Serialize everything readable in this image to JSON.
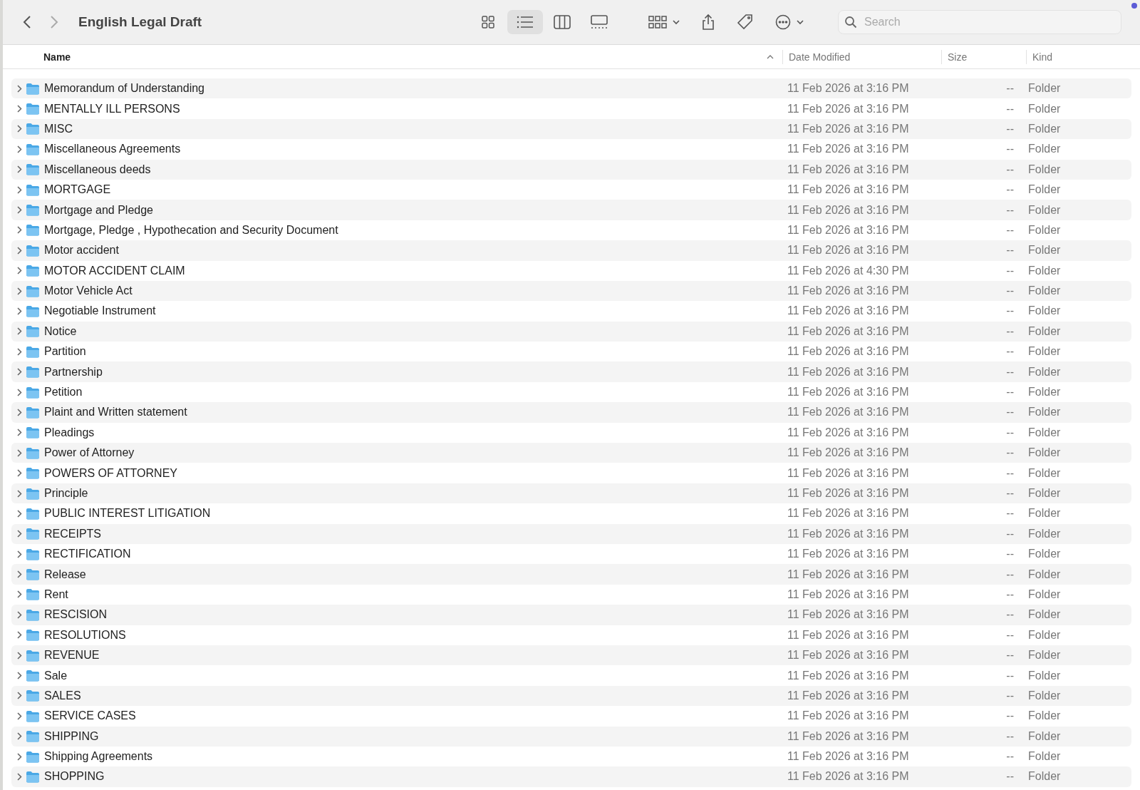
{
  "window": {
    "title": "English Legal Draft"
  },
  "toolbar": {
    "views": [
      {
        "kind": "icons",
        "selected": false
      },
      {
        "kind": "list",
        "selected": true
      },
      {
        "kind": "columns",
        "selected": false
      },
      {
        "kind": "gallery",
        "selected": false
      }
    ],
    "search": {
      "placeholder": "Search"
    }
  },
  "table": {
    "columns": [
      {
        "label": "Name",
        "sorted": true
      },
      {
        "label": "Date Modified",
        "sorted": false
      },
      {
        "label": "Size",
        "sorted": false
      },
      {
        "label": "Kind",
        "sorted": false
      }
    ],
    "rows": [
      {
        "name": "Memorandum of Understanding",
        "date": "11 Feb 2026 at 3:16 PM",
        "size": "--",
        "kind": "Folder",
        "expanded": false
      },
      {
        "name": "MENTALLY ILL PERSONS",
        "date": "11 Feb 2026 at 3:16 PM",
        "size": "--",
        "kind": "Folder",
        "expanded": false
      },
      {
        "name": "MISC",
        "date": "11 Feb 2026 at 3:16 PM",
        "size": "--",
        "kind": "Folder",
        "expanded": false
      },
      {
        "name": "Miscellaneous Agreements",
        "date": "11 Feb 2026 at 3:16 PM",
        "size": "--",
        "kind": "Folder",
        "expanded": false
      },
      {
        "name": "Miscellaneous deeds",
        "date": "11 Feb 2026 at 3:16 PM",
        "size": "--",
        "kind": "Folder",
        "expanded": false
      },
      {
        "name": "MORTGAGE",
        "date": "11 Feb 2026 at 3:16 PM",
        "size": "--",
        "kind": "Folder",
        "expanded": false
      },
      {
        "name": "Mortgage and Pledge",
        "date": "11 Feb 2026 at 3:16 PM",
        "size": "--",
        "kind": "Folder",
        "expanded": false
      },
      {
        "name": "Mortgage, Pledge , Hypothecation and Security Document",
        "date": "11 Feb 2026 at 3:16 PM",
        "size": "--",
        "kind": "Folder",
        "expanded": false
      },
      {
        "name": "Motor accident",
        "date": "11 Feb 2026 at 3:16 PM",
        "size": "--",
        "kind": "Folder",
        "expanded": false
      },
      {
        "name": "MOTOR ACCIDENT CLAIM",
        "date": "11 Feb 2026 at 4:30 PM",
        "size": "--",
        "kind": "Folder",
        "expanded": false
      },
      {
        "name": "Motor Vehicle Act",
        "date": "11 Feb 2026 at 3:16 PM",
        "size": "--",
        "kind": "Folder",
        "expanded": false
      },
      {
        "name": "Negotiable Instrument",
        "date": "11 Feb 2026 at 3:16 PM",
        "size": "--",
        "kind": "Folder",
        "expanded": false
      },
      {
        "name": "Notice",
        "date": "11 Feb 2026 at 3:16 PM",
        "size": "--",
        "kind": "Folder",
        "expanded": false
      },
      {
        "name": "Partition",
        "date": "11 Feb 2026 at 3:16 PM",
        "size": "--",
        "kind": "Folder",
        "expanded": false
      },
      {
        "name": "Partnership",
        "date": "11 Feb 2026 at 3:16 PM",
        "size": "--",
        "kind": "Folder",
        "expanded": false
      },
      {
        "name": "Petition",
        "date": "11 Feb 2026 at 3:16 PM",
        "size": "--",
        "kind": "Folder",
        "expanded": false
      },
      {
        "name": "Plaint and Written statement",
        "date": "11 Feb 2026 at 3:16 PM",
        "size": "--",
        "kind": "Folder",
        "expanded": false
      },
      {
        "name": "Pleadings",
        "date": "11 Feb 2026 at 3:16 PM",
        "size": "--",
        "kind": "Folder",
        "expanded": false
      },
      {
        "name": "Power of Attorney",
        "date": "11 Feb 2026 at 3:16 PM",
        "size": "--",
        "kind": "Folder",
        "expanded": false
      },
      {
        "name": "POWERS OF ATTORNEY",
        "date": "11 Feb 2026 at 3:16 PM",
        "size": "--",
        "kind": "Folder",
        "expanded": false
      },
      {
        "name": "Principle",
        "date": "11 Feb 2026 at 3:16 PM",
        "size": "--",
        "kind": "Folder",
        "expanded": false
      },
      {
        "name": "PUBLIC INTEREST LITIGATION",
        "date": "11 Feb 2026 at 3:16 PM",
        "size": "--",
        "kind": "Folder",
        "expanded": false
      },
      {
        "name": "RECEIPTS",
        "date": "11 Feb 2026 at 3:16 PM",
        "size": "--",
        "kind": "Folder",
        "expanded": false
      },
      {
        "name": "RECTIFICATION",
        "date": "11 Feb 2026 at 3:16 PM",
        "size": "--",
        "kind": "Folder",
        "expanded": false
      },
      {
        "name": "Release",
        "date": "11 Feb 2026 at 3:16 PM",
        "size": "--",
        "kind": "Folder",
        "expanded": false
      },
      {
        "name": "Rent",
        "date": "11 Feb 2026 at 3:16 PM",
        "size": "--",
        "kind": "Folder",
        "expanded": false
      },
      {
        "name": "RESCISION",
        "date": "11 Feb 2026 at 3:16 PM",
        "size": "--",
        "kind": "Folder",
        "expanded": false
      },
      {
        "name": "RESOLUTIONS",
        "date": "11 Feb 2026 at 3:16 PM",
        "size": "--",
        "kind": "Folder",
        "expanded": false
      },
      {
        "name": "REVENUE",
        "date": "11 Feb 2026 at 3:16 PM",
        "size": "--",
        "kind": "Folder",
        "expanded": false
      },
      {
        "name": "Sale",
        "date": "11 Feb 2026 at 3:16 PM",
        "size": "--",
        "kind": "Folder",
        "expanded": false
      },
      {
        "name": "SALES",
        "date": "11 Feb 2026 at 3:16 PM",
        "size": "--",
        "kind": "Folder",
        "expanded": false
      },
      {
        "name": "SERVICE CASES",
        "date": "11 Feb 2026 at 3:16 PM",
        "size": "--",
        "kind": "Folder",
        "expanded": false
      },
      {
        "name": "SHIPPING",
        "date": "11 Feb 2026 at 3:16 PM",
        "size": "--",
        "kind": "Folder",
        "expanded": false
      },
      {
        "name": "Shipping Agreements",
        "date": "11 Feb 2026 at 3:16 PM",
        "size": "--",
        "kind": "Folder",
        "expanded": false
      },
      {
        "name": "SHOPPING",
        "date": "11 Feb 2026 at 3:16 PM",
        "size": "--",
        "kind": "Folder",
        "expanded": false
      }
    ]
  }
}
